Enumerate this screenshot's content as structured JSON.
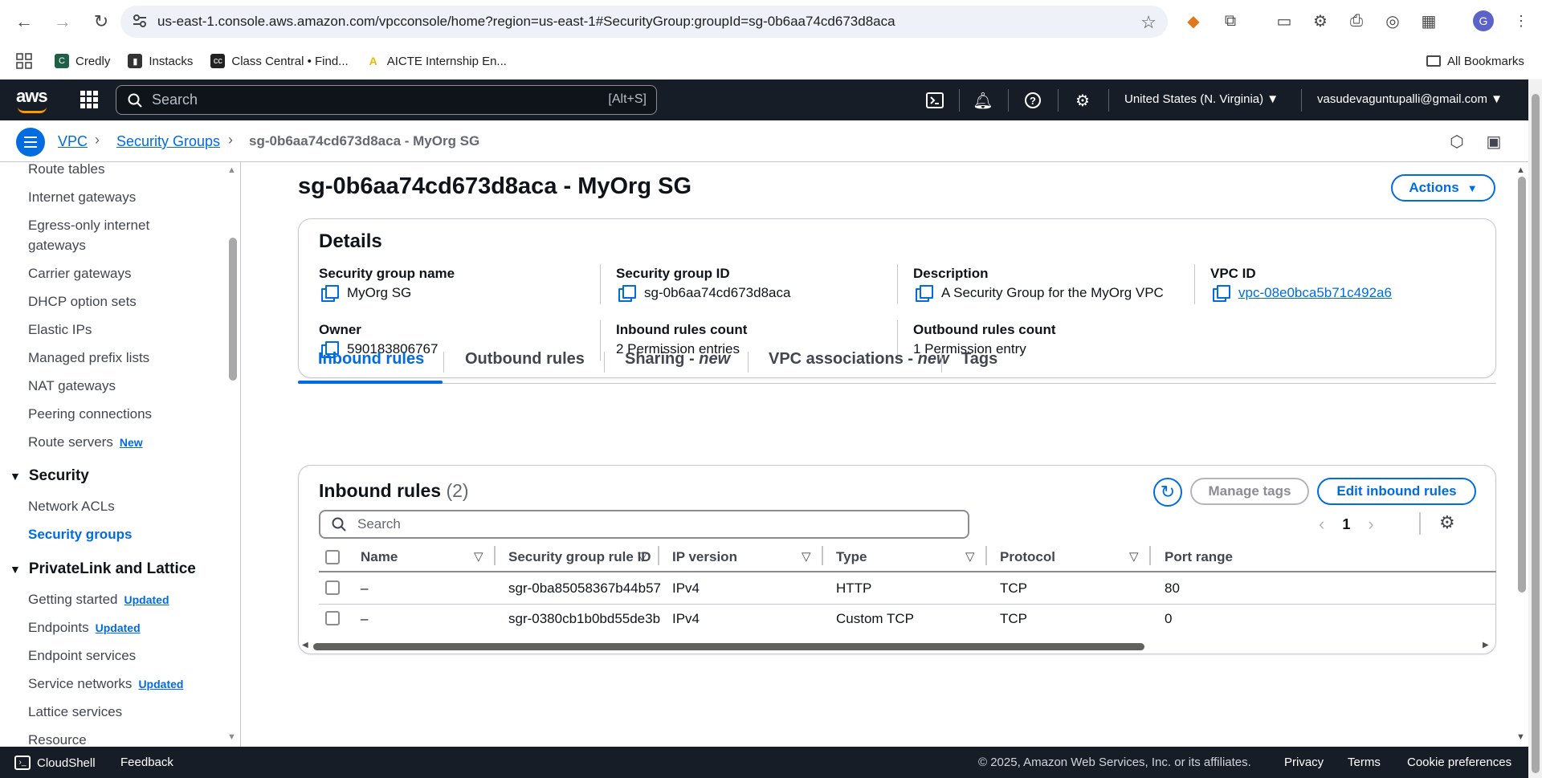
{
  "browser": {
    "url": "us-east-1.console.aws.amazon.com/vpcconsole/home?region=us-east-1#SecurityGroup:groupId=sg-0b6aa74cd673d8aca",
    "profile_initial": "G",
    "bookmarks": [
      {
        "label": "Credly",
        "color": "#1e5f46"
      },
      {
        "label": "Instacks",
        "color": "#333333"
      },
      {
        "label": "Class Central • Find...",
        "color": "#222222"
      },
      {
        "label": "AICTE Internship En...",
        "color": "#f2b705"
      }
    ],
    "all_bookmarks": "All Bookmarks"
  },
  "aws_header": {
    "logo": "aws",
    "search_placeholder": "Search",
    "search_shortcut": "[Alt+S]",
    "region": "United States (N. Virginia) ▼",
    "account": "vasudevaguntupalli@gmail.com ▼"
  },
  "breadcrumb": {
    "vpc": "VPC",
    "security_groups": "Security Groups",
    "current": "sg-0b6aa74cd673d8aca - MyOrg SG"
  },
  "sidebar": {
    "items_top": [
      "Route tables",
      "Internet gateways",
      "Egress-only internet",
      "gateways",
      "Carrier gateways",
      "DHCP option sets",
      "Elastic IPs",
      "Managed prefix lists",
      "NAT gateways",
      "Peering connections",
      "Route servers"
    ],
    "new_badge": "New",
    "section_security": "Security",
    "network_acls": "Network ACLs",
    "security_groups": "Security groups",
    "section_privatelink": "PrivateLink and Lattice",
    "getting_started": "Getting started",
    "endpoints": "Endpoints",
    "endpoint_services": "Endpoint services",
    "service_networks": "Service networks",
    "lattice_services": "Lattice services",
    "resource": "Resource",
    "updated_badge": "Updated"
  },
  "page": {
    "title": "sg-0b6aa74cd673d8aca - MyOrg SG",
    "actions_label": "Actions"
  },
  "details": {
    "heading": "Details",
    "sg_name_label": "Security group name",
    "sg_name": "MyOrg SG",
    "sg_id_label": "Security group ID",
    "sg_id": "sg-0b6aa74cd673d8aca",
    "description_label": "Description",
    "description": "A Security Group for the MyOrg VPC",
    "vpc_id_label": "VPC ID",
    "vpc_id": "vpc-08e0bca5b71c492a6",
    "owner_label": "Owner",
    "owner": "590183806767",
    "inbound_count_label": "Inbound rules count",
    "inbound_count": "2 Permission entries",
    "outbound_count_label": "Outbound rules count",
    "outbound_count": "1 Permission entry"
  },
  "tabs": {
    "inbound": "Inbound rules",
    "outbound": "Outbound rules",
    "sharing": "Sharing - ",
    "vpc_assoc": "VPC associations - ",
    "new_suffix": "new",
    "tags": "Tags"
  },
  "inbound_table": {
    "title": "Inbound rules",
    "count": "(2)",
    "manage_tags": "Manage tags",
    "edit_inbound": "Edit inbound rules",
    "search_placeholder": "Search",
    "page_number": "1",
    "columns": [
      "Name",
      "Security group rule ID",
      "IP version",
      "Type",
      "Protocol",
      "Port range"
    ],
    "rows": [
      {
        "name": "–",
        "rule_id": "sgr-0ba85058367b44b57",
        "ip_version": "IPv4",
        "type": "HTTP",
        "protocol": "TCP",
        "port_range": "80"
      },
      {
        "name": "–",
        "rule_id": "sgr-0380cb1b0bd55de3b",
        "ip_version": "IPv4",
        "type": "Custom TCP",
        "protocol": "TCP",
        "port_range": "0"
      }
    ]
  },
  "footer": {
    "cloudshell": "CloudShell",
    "feedback": "Feedback",
    "copyright": "© 2025, Amazon Web Services, Inc. or its affiliates.",
    "privacy": "Privacy",
    "terms": "Terms",
    "cookie": "Cookie preferences"
  },
  "colors": {
    "link_blue": "#006ce0",
    "header_dark": "#161d26",
    "aws_orange": "#ff9900"
  }
}
